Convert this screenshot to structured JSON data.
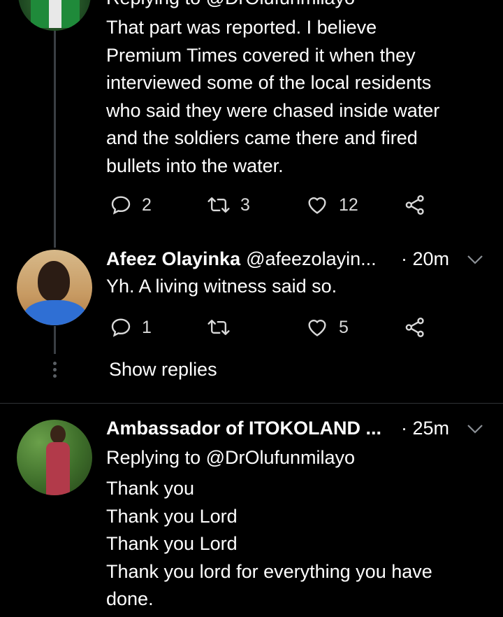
{
  "tweet1": {
    "replying_cut": "Replying to @DrOlufunmilayo",
    "text": "That part was reported. I believe\nPremium Times covered it when they\ninterviewed some of the local residents\nwho said they were chased inside water\nand the soldiers came there and fired\nbullets into the water.",
    "replies": "2",
    "retweets": "3",
    "likes": "12"
  },
  "tweet2": {
    "name": "Afeez Olayinka",
    "handle": "@afeezolayin...",
    "time": "· 20m",
    "text": "Yh. A living witness said so.",
    "replies": "1",
    "likes": "5"
  },
  "show_replies": "Show replies",
  "tweet3": {
    "name": "Ambassador of ITOKOLAND ...",
    "time": "· 25m",
    "replying": "Replying to @DrOlufunmilayo",
    "text": "Thank you\nThank you Lord\nThank you Lord\nThank you lord for everything you have\ndone."
  },
  "icons": [
    "reply-icon",
    "retweet-icon",
    "like-icon",
    "share-icon",
    "chevron-down-icon"
  ],
  "colors": {
    "background": "#000000",
    "text": "#ffffff",
    "icon": "#d9d9d9",
    "thread_line": "#3a3f44"
  }
}
